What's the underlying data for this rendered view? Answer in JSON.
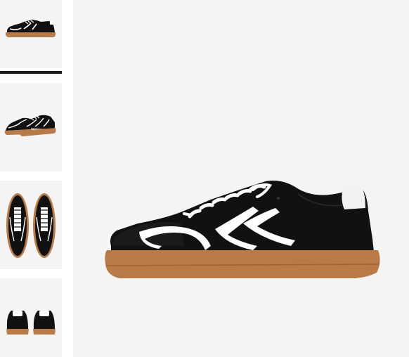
{
  "gallery": {
    "selected_index": 0,
    "thumbnails": [
      {
        "view": "side"
      },
      {
        "view": "pair-angle"
      },
      {
        "view": "top"
      },
      {
        "view": "back"
      }
    ],
    "main_view": "side"
  },
  "colors": {
    "background": "#f4f4f4",
    "upper": "#111111",
    "stripe": "#ffffff",
    "sole": "#b97a45",
    "indicator": "#1a1a1a"
  }
}
